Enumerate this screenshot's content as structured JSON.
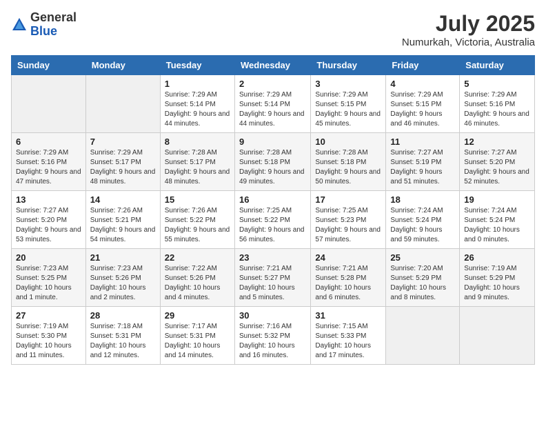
{
  "logo": {
    "general": "General",
    "blue": "Blue"
  },
  "title": {
    "month_year": "July 2025",
    "location": "Numurkah, Victoria, Australia"
  },
  "calendar": {
    "headers": [
      "Sunday",
      "Monday",
      "Tuesday",
      "Wednesday",
      "Thursday",
      "Friday",
      "Saturday"
    ],
    "weeks": [
      [
        {
          "day": "",
          "sunrise": "",
          "sunset": "",
          "daylight": ""
        },
        {
          "day": "",
          "sunrise": "",
          "sunset": "",
          "daylight": ""
        },
        {
          "day": "1",
          "sunrise": "Sunrise: 7:29 AM",
          "sunset": "Sunset: 5:14 PM",
          "daylight": "Daylight: 9 hours and 44 minutes."
        },
        {
          "day": "2",
          "sunrise": "Sunrise: 7:29 AM",
          "sunset": "Sunset: 5:14 PM",
          "daylight": "Daylight: 9 hours and 44 minutes."
        },
        {
          "day": "3",
          "sunrise": "Sunrise: 7:29 AM",
          "sunset": "Sunset: 5:15 PM",
          "daylight": "Daylight: 9 hours and 45 minutes."
        },
        {
          "day": "4",
          "sunrise": "Sunrise: 7:29 AM",
          "sunset": "Sunset: 5:15 PM",
          "daylight": "Daylight: 9 hours and 46 minutes."
        },
        {
          "day": "5",
          "sunrise": "Sunrise: 7:29 AM",
          "sunset": "Sunset: 5:16 PM",
          "daylight": "Daylight: 9 hours and 46 minutes."
        }
      ],
      [
        {
          "day": "6",
          "sunrise": "Sunrise: 7:29 AM",
          "sunset": "Sunset: 5:16 PM",
          "daylight": "Daylight: 9 hours and 47 minutes."
        },
        {
          "day": "7",
          "sunrise": "Sunrise: 7:29 AM",
          "sunset": "Sunset: 5:17 PM",
          "daylight": "Daylight: 9 hours and 48 minutes."
        },
        {
          "day": "8",
          "sunrise": "Sunrise: 7:28 AM",
          "sunset": "Sunset: 5:17 PM",
          "daylight": "Daylight: 9 hours and 48 minutes."
        },
        {
          "day": "9",
          "sunrise": "Sunrise: 7:28 AM",
          "sunset": "Sunset: 5:18 PM",
          "daylight": "Daylight: 9 hours and 49 minutes."
        },
        {
          "day": "10",
          "sunrise": "Sunrise: 7:28 AM",
          "sunset": "Sunset: 5:18 PM",
          "daylight": "Daylight: 9 hours and 50 minutes."
        },
        {
          "day": "11",
          "sunrise": "Sunrise: 7:27 AM",
          "sunset": "Sunset: 5:19 PM",
          "daylight": "Daylight: 9 hours and 51 minutes."
        },
        {
          "day": "12",
          "sunrise": "Sunrise: 7:27 AM",
          "sunset": "Sunset: 5:20 PM",
          "daylight": "Daylight: 9 hours and 52 minutes."
        }
      ],
      [
        {
          "day": "13",
          "sunrise": "Sunrise: 7:27 AM",
          "sunset": "Sunset: 5:20 PM",
          "daylight": "Daylight: 9 hours and 53 minutes."
        },
        {
          "day": "14",
          "sunrise": "Sunrise: 7:26 AM",
          "sunset": "Sunset: 5:21 PM",
          "daylight": "Daylight: 9 hours and 54 minutes."
        },
        {
          "day": "15",
          "sunrise": "Sunrise: 7:26 AM",
          "sunset": "Sunset: 5:22 PM",
          "daylight": "Daylight: 9 hours and 55 minutes."
        },
        {
          "day": "16",
          "sunrise": "Sunrise: 7:25 AM",
          "sunset": "Sunset: 5:22 PM",
          "daylight": "Daylight: 9 hours and 56 minutes."
        },
        {
          "day": "17",
          "sunrise": "Sunrise: 7:25 AM",
          "sunset": "Sunset: 5:23 PM",
          "daylight": "Daylight: 9 hours and 57 minutes."
        },
        {
          "day": "18",
          "sunrise": "Sunrise: 7:24 AM",
          "sunset": "Sunset: 5:24 PM",
          "daylight": "Daylight: 9 hours and 59 minutes."
        },
        {
          "day": "19",
          "sunrise": "Sunrise: 7:24 AM",
          "sunset": "Sunset: 5:24 PM",
          "daylight": "Daylight: 10 hours and 0 minutes."
        }
      ],
      [
        {
          "day": "20",
          "sunrise": "Sunrise: 7:23 AM",
          "sunset": "Sunset: 5:25 PM",
          "daylight": "Daylight: 10 hours and 1 minute."
        },
        {
          "day": "21",
          "sunrise": "Sunrise: 7:23 AM",
          "sunset": "Sunset: 5:26 PM",
          "daylight": "Daylight: 10 hours and 2 minutes."
        },
        {
          "day": "22",
          "sunrise": "Sunrise: 7:22 AM",
          "sunset": "Sunset: 5:26 PM",
          "daylight": "Daylight: 10 hours and 4 minutes."
        },
        {
          "day": "23",
          "sunrise": "Sunrise: 7:21 AM",
          "sunset": "Sunset: 5:27 PM",
          "daylight": "Daylight: 10 hours and 5 minutes."
        },
        {
          "day": "24",
          "sunrise": "Sunrise: 7:21 AM",
          "sunset": "Sunset: 5:28 PM",
          "daylight": "Daylight: 10 hours and 6 minutes."
        },
        {
          "day": "25",
          "sunrise": "Sunrise: 7:20 AM",
          "sunset": "Sunset: 5:29 PM",
          "daylight": "Daylight: 10 hours and 8 minutes."
        },
        {
          "day": "26",
          "sunrise": "Sunrise: 7:19 AM",
          "sunset": "Sunset: 5:29 PM",
          "daylight": "Daylight: 10 hours and 9 minutes."
        }
      ],
      [
        {
          "day": "27",
          "sunrise": "Sunrise: 7:19 AM",
          "sunset": "Sunset: 5:30 PM",
          "daylight": "Daylight: 10 hours and 11 minutes."
        },
        {
          "day": "28",
          "sunrise": "Sunrise: 7:18 AM",
          "sunset": "Sunset: 5:31 PM",
          "daylight": "Daylight: 10 hours and 12 minutes."
        },
        {
          "day": "29",
          "sunrise": "Sunrise: 7:17 AM",
          "sunset": "Sunset: 5:31 PM",
          "daylight": "Daylight: 10 hours and 14 minutes."
        },
        {
          "day": "30",
          "sunrise": "Sunrise: 7:16 AM",
          "sunset": "Sunset: 5:32 PM",
          "daylight": "Daylight: 10 hours and 16 minutes."
        },
        {
          "day": "31",
          "sunrise": "Sunrise: 7:15 AM",
          "sunset": "Sunset: 5:33 PM",
          "daylight": "Daylight: 10 hours and 17 minutes."
        },
        {
          "day": "",
          "sunrise": "",
          "sunset": "",
          "daylight": ""
        },
        {
          "day": "",
          "sunrise": "",
          "sunset": "",
          "daylight": ""
        }
      ]
    ]
  }
}
